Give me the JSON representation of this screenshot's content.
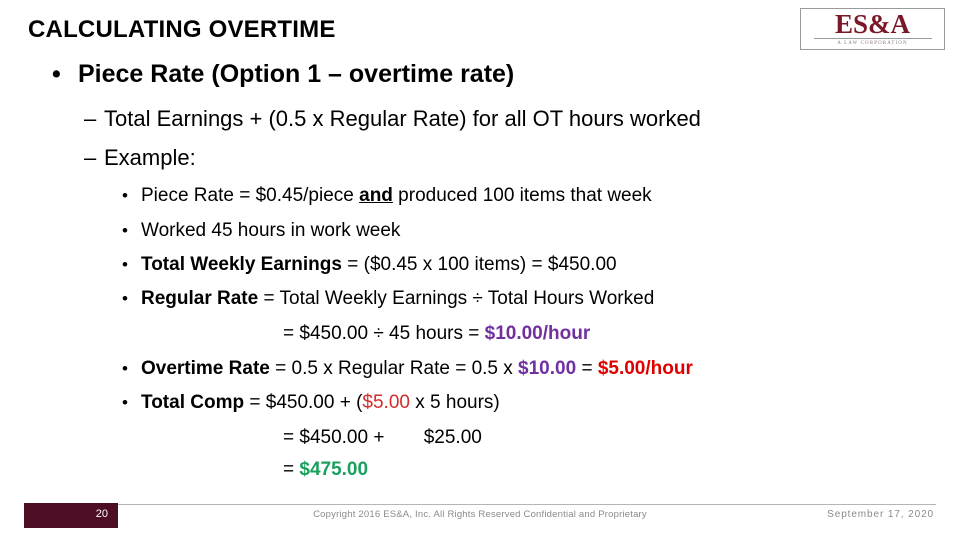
{
  "slide": {
    "title": "CALCULATING OVERTIME",
    "logo": {
      "wordmark": "ES&A",
      "tagline": "A LAW CORPORATION"
    },
    "bullet_level1": {
      "marker": "•",
      "text": "Piece Rate (Option 1 – overtime rate)"
    },
    "bullet_level2": [
      {
        "marker": "–",
        "text": "Total Earnings + (0.5 x Regular Rate) for all OT hours worked"
      },
      {
        "marker": "–",
        "text": "Example:"
      }
    ],
    "bullet_level3": {
      "marker": "•",
      "items": {
        "piece_rate": {
          "pre": "Piece Rate = $0.45/piece ",
          "emph": "and",
          "post": " produced 100 items that week"
        },
        "worked_hours": "Worked 45 hours in work week",
        "total_weekly_earnings": {
          "label": "Total Weekly Earnings",
          "rest": " = ($0.45 x 100 items) =  $450.00"
        },
        "regular_rate": {
          "label": "Regular Rate",
          "rest": " = Total Weekly Earnings ÷ Total Hours Worked"
        },
        "regular_rate_result": {
          "pre": "= $450.00 ÷ 45 hours = ",
          "value": "$10.00/hour"
        },
        "overtime_rate": {
          "label": "Overtime Rate",
          "mid": " = 0.5 x Regular Rate = 0.5 x ",
          "value_purple": "$10.00",
          "sep": " = ",
          "value_red": "$5.00/hour"
        },
        "total_comp": {
          "label": "Total Comp",
          "mid": " = $450.00 + (",
          "value_red": "$5.00",
          "post": " x 5 hours)"
        },
        "total_comp_line2_a": "= $450.00 + ",
        "total_comp_line2_b": "$25.00",
        "total_comp_result_pre": "= ",
        "total_comp_result_value": "$475.00"
      }
    },
    "footer": {
      "page_number": "20",
      "copyright": "Copyright 2016 ES&A, Inc. All Rights Reserved Confidential and Proprietary",
      "date": "September 17, 2020"
    },
    "colors": {
      "purple": "#7030A0",
      "red": "#E00000",
      "green": "#1AA05E",
      "maroon": "#4C0D25",
      "logo_red": "#7B1828"
    }
  }
}
